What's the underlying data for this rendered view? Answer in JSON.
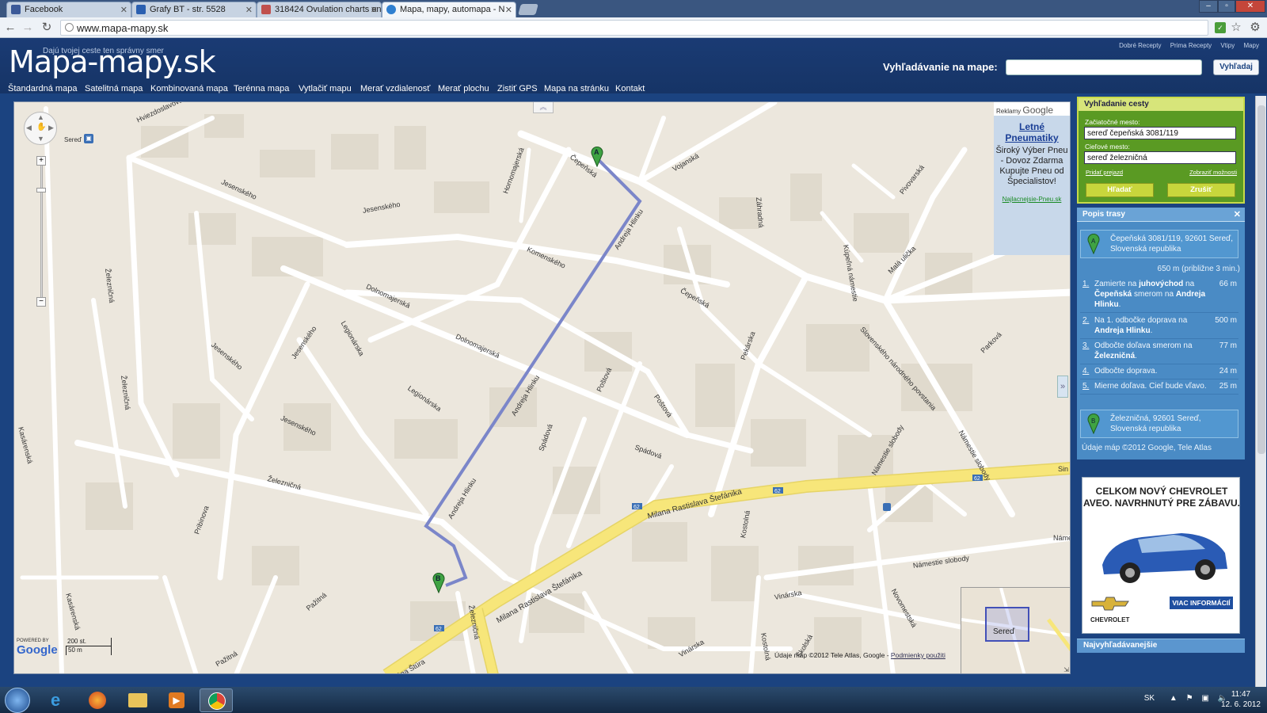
{
  "browser": {
    "tabs": [
      {
        "label": "Facebook",
        "color": "#3b5998"
      },
      {
        "label": "Grafy BT - str. 5528",
        "color": "#2a5fb0"
      },
      {
        "label": "318424 Ovulation charts on",
        "color": "#c0504d"
      },
      {
        "label": "Mapa, mapy, automapa - N",
        "color": "#2f7fd0"
      }
    ],
    "url": "www.mapa-mapy.sk"
  },
  "header": {
    "logo": "Mapa-mapy.sk",
    "tagline": "Dajú tvojej ceste ten správny smer",
    "top_links": [
      "Dobré Recepty",
      "Prima Recepty",
      "Vtipy",
      "Mapy"
    ],
    "search_label": "Vyhľadávanie na mape:",
    "search_placeholder": "",
    "search_button": "Vyhľadaj"
  },
  "menu": [
    "Štandardná mapa",
    "Satelitná mapa",
    "Kombinovaná mapa",
    "Terénna mapa",
    "Vytlačiť mapu",
    "Merať vzdialenosť",
    "Merať plochu",
    "Zistiť GPS",
    "Mapa na stránku",
    "Kontakt"
  ],
  "map": {
    "ads_header": "Reklamy",
    "ads_brand": "Google",
    "ad_title": "Letné Pneumatiky",
    "ad_text": "Široký Výber Pneu - Dovoz Zdarma Kupujte Pneu od Špecialistov!",
    "ad_url": "Najlacnejsie-Pneu.sk",
    "marker_a": "A",
    "marker_b": "B",
    "scale_top": "200 st.",
    "scale_bottom": "50 m",
    "powered_by": "POWERED BY",
    "google_logo": "Google",
    "copyright": "Údaje máp ©2012 Tele Atlas, Google - ",
    "terms_link": "Podmienky použiti",
    "minimap_label": "Sereď",
    "place_label": "Sereď",
    "street_labels": [
      "Hviezdoslavova",
      "Jesenského",
      "Jesenského",
      "Čepeňská",
      "Vojanská",
      "Hornomajerská",
      "Andreja Hlinku",
      "Komenského",
      "Záhradná",
      "Pivovarská",
      "Dolnomajerská",
      "Dolnomajerská",
      "Legionárska",
      "Legionárska",
      "Železničná",
      "Železničná",
      "Železničná",
      "Kasárenská",
      "Kasárenská",
      "Jesenského",
      "Jesenského",
      "Jesenského",
      "Poštová",
      "Poštová",
      "Spádová",
      "Spádová",
      "Pekárska",
      "Čepeňská",
      "Malá ulička",
      "Kúpeľná námestie",
      "Slovenského národného povstania",
      "Parková",
      "Námestie slobody",
      "Námestie slobody",
      "Námestie slobody",
      "Milana Rastislava Štefánika",
      "Milana Rastislava Štefánika",
      "Pribinova",
      "Pažitná",
      "Pažitná",
      "Vinárska",
      "Vinárska",
      "Kostolná",
      "Kostolná",
      "Novomestská",
      "Školská",
      "Andreja Hlinku",
      "Andreja Hlinku",
      "Železničná",
      "Jána Štúra",
      "Sin",
      "Náme"
    ]
  },
  "route_panel": {
    "title": "Vyhľadanie cesty",
    "start_label": "Začiatočné mesto:",
    "start_value": "sereď čepeňská 3081/119",
    "end_label": "Cieľové mesto:",
    "end_value": "sereď železničná",
    "add_stop": "Pridať prejazd",
    "show_options": "Zobraziť možnosti",
    "search_btn": "Hľadať",
    "cancel_btn": "Zrušiť"
  },
  "route_description": {
    "title": "Popis trasy",
    "start": "Čepeňská 3081/119, 92601 Sereď, Slovenská republika",
    "summary": "650 m (približne 3 min.)",
    "steps": [
      {
        "n": "1.",
        "text_html_pre": "Zamierte na ",
        "b1": "juhovýchod",
        "mid": " na ",
        "b2": "Čepeňská",
        "mid2": " smerom na ",
        "b3": "Andreja Hlinku",
        "end": ".",
        "dist": "66 m"
      },
      {
        "n": "2.",
        "text_html_pre": "Na 1. odbočke doprava na ",
        "b1": "Andreja Hlinku",
        "mid": ".",
        "b2": "",
        "mid2": "",
        "b3": "",
        "end": "",
        "dist": "500 m"
      },
      {
        "n": "3.",
        "text_html_pre": "Odbočte doľava smerom na ",
        "b1": "Železničná",
        "mid": ".",
        "b2": "",
        "mid2": "",
        "b3": "",
        "end": "",
        "dist": "77 m"
      },
      {
        "n": "4.",
        "text_html_pre": "Odbočte doprava.",
        "b1": "",
        "mid": "",
        "b2": "",
        "mid2": "",
        "b3": "",
        "end": "",
        "dist": "24 m"
      },
      {
        "n": "5.",
        "text_html_pre": "Mierne doľava. Cieľ bude vľavo.",
        "b1": "",
        "mid": "",
        "b2": "",
        "mid2": "",
        "b3": "",
        "end": "",
        "dist": "25 m"
      }
    ],
    "end": "Železničná, 92601 Sereď, Slovenská republika",
    "credits": "Údaje máp ©2012 Google, Tele Atlas"
  },
  "sidebar_ad": {
    "headline": "CELKOM NOVÝ CHEVROLET AVEO. NAVRHNUTÝ PRE ZÁBAVU.",
    "cta": "VIAC INFORMÁCIÍ",
    "brand": "CHEVROLET"
  },
  "popular": "Najvyhľadávanejšie",
  "taskbar": {
    "lang": "SK",
    "time": "11:47",
    "date": "12. 6. 2012"
  },
  "colors": {
    "header_bg": "#1a3b74",
    "route_green": "#5a9a23",
    "route_line": "#7b86c9",
    "main_road": "#f7e67a",
    "desc_blue": "#4a8bc5"
  }
}
